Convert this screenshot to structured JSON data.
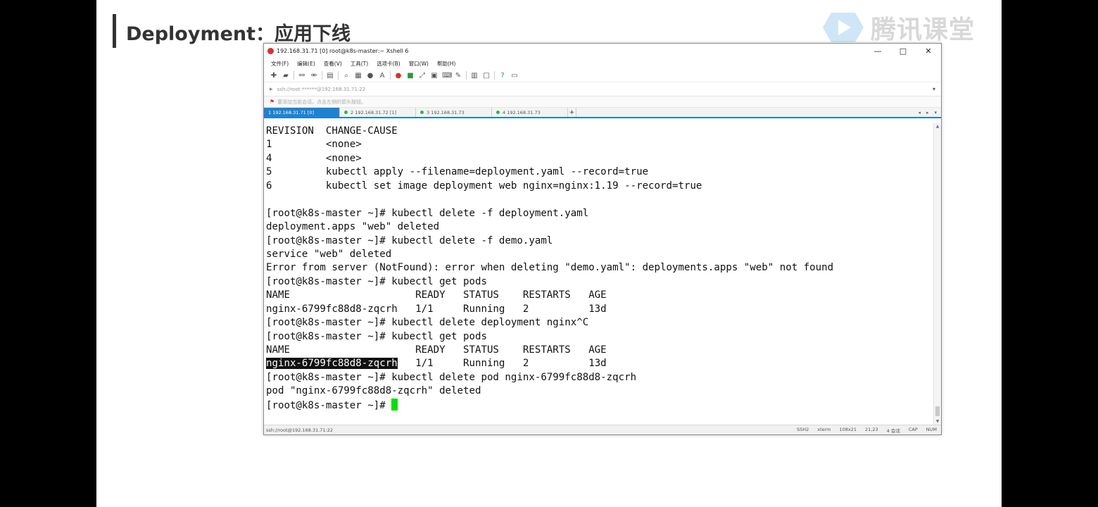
{
  "slide": {
    "title": "Deployment：应用下线",
    "brand": "腾讯课堂"
  },
  "window": {
    "title": "192.168.31.71 [0]   root@k8s-master:~   Xshell 6",
    "minimize": "—",
    "maximize": "□",
    "close": "✕"
  },
  "menu": [
    "文件(F)",
    "编辑(E)",
    "查看(V)",
    "工具(T)",
    "选项卡(B)",
    "窗口(W)",
    "帮助(H)"
  ],
  "address": {
    "value": "ssh://root:******@192.168.31.71:22"
  },
  "hint": "要添加当前会话，点击左侧的箭头按钮。",
  "tabs": [
    {
      "label": "1 192.168.31.71 [0]",
      "active": true
    },
    {
      "label": "2 192.168.31.72 [1]",
      "active": false
    },
    {
      "label": "3 192.168.31.73",
      "active": false
    },
    {
      "label": "4 192.168.31.73",
      "active": false
    }
  ],
  "terminal": {
    "lines": [
      "REVISION  CHANGE-CAUSE",
      "1         <none>",
      "4         <none>",
      "5         kubectl apply --filename=deployment.yaml --record=true",
      "6         kubectl set image deployment web nginx=nginx:1.19 --record=true",
      "",
      "[root@k8s-master ~]# kubectl delete -f deployment.yaml",
      "deployment.apps \"web\" deleted",
      "[root@k8s-master ~]# kubectl delete -f demo.yaml",
      "service \"web\" deleted",
      "Error from server (NotFound): error when deleting \"demo.yaml\": deployments.apps \"web\" not found",
      "[root@k8s-master ~]# kubectl get pods",
      "NAME                     READY   STATUS    RESTARTS   AGE",
      "nginx-6799fc88d8-zqcrh   1/1     Running   2          13d",
      "[root@k8s-master ~]# kubectl delete deployment nginx^C",
      "[root@k8s-master ~]# kubectl get pods"
    ],
    "header2": "NAME                     READY   STATUS    RESTARTS   AGE",
    "selected_pod": "nginx-6799fc88d8-zqcrh",
    "selected_rest": "   1/1     Running   2          13d",
    "delete_cmd": "[root@k8s-master ~]# kubectl delete pod nginx-6799fc88d8-zqcrh",
    "delete_out": "pod \"nginx-6799fc88d8-zqcrh\" deleted",
    "prompt": "[root@k8s-master ~]# "
  },
  "status": {
    "left": "ssh://root@192.168.31.71:22",
    "items": [
      "SSH2",
      "xterm",
      "108x21",
      "21,23",
      "4 会话",
      "CAP",
      "NUM"
    ]
  }
}
